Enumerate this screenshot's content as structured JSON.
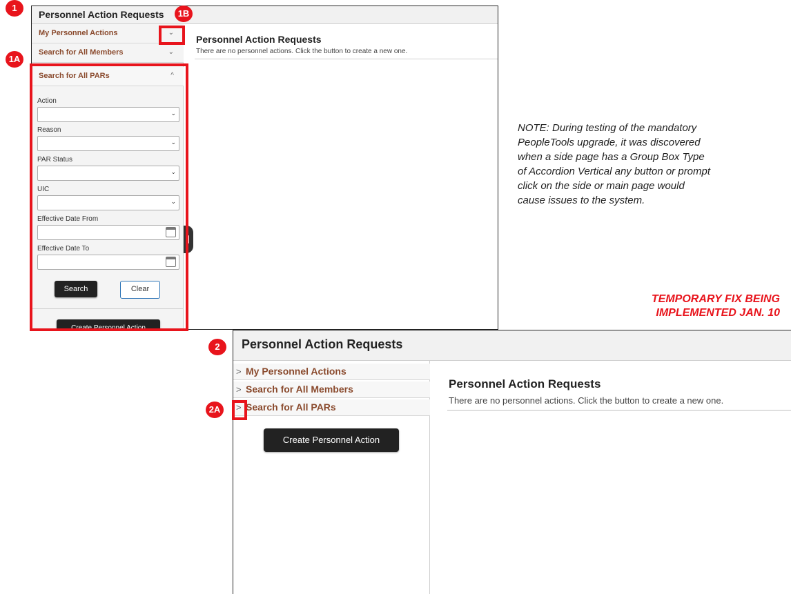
{
  "badges": {
    "b1": "1",
    "b1a": "1A",
    "b1b": "1B",
    "b2": "2",
    "b2a": "2A"
  },
  "shot1": {
    "header_title": "Personnel Action Requests",
    "accordion": [
      {
        "label": "My Personnel Actions",
        "chevron": "⌄"
      },
      {
        "label": "Search for All Members",
        "chevron": "⌄"
      },
      {
        "label": "Search for All PARs",
        "chevron": "^"
      }
    ],
    "fields": [
      {
        "label": "Action",
        "kind": "dropdown"
      },
      {
        "label": "Reason",
        "kind": "dropdown"
      },
      {
        "label": "PAR Status",
        "kind": "dropdown"
      },
      {
        "label": "UIC",
        "kind": "dropdown"
      },
      {
        "label": "Effective Date From",
        "kind": "date"
      },
      {
        "label": "Effective Date To",
        "kind": "date"
      }
    ],
    "search_button": "Search",
    "clear_button": "Clear",
    "create_button": "Create Personnel Action",
    "main_title": "Personnel Action Requests",
    "main_message": "There are no personnel actions. Click the button to create a new one."
  },
  "note": {
    "line1": "NOTE: During testing of the mandatory",
    "line2": "PeopleTools upgrade, it was discovered",
    "line3": "when a side page has a Group Box Type",
    "line4": "of Accordion Vertical any button or prompt",
    "line5": "click on the side or main page would",
    "line6": "cause issues to the system.",
    "fix_line1": "TEMPORARY FIX BEING",
    "fix_line2": "IMPLEMENTED JAN. 10"
  },
  "shot2": {
    "header_title": "Personnel Action Requests",
    "accordion": [
      {
        "label": "My Personnel Actions",
        "arrow": ">"
      },
      {
        "label": "Search for All Members",
        "arrow": ">"
      },
      {
        "label": "Search for All PARs",
        "arrow": ">"
      }
    ],
    "create_button": "Create Personnel Action",
    "main_title": "Personnel Action Requests",
    "main_message": "There are no personnel actions. Click the button to create a new one."
  },
  "colors": {
    "highlight": "#e8141c",
    "accordion_label": "#8a4a2d",
    "dark_button": "#222222"
  }
}
